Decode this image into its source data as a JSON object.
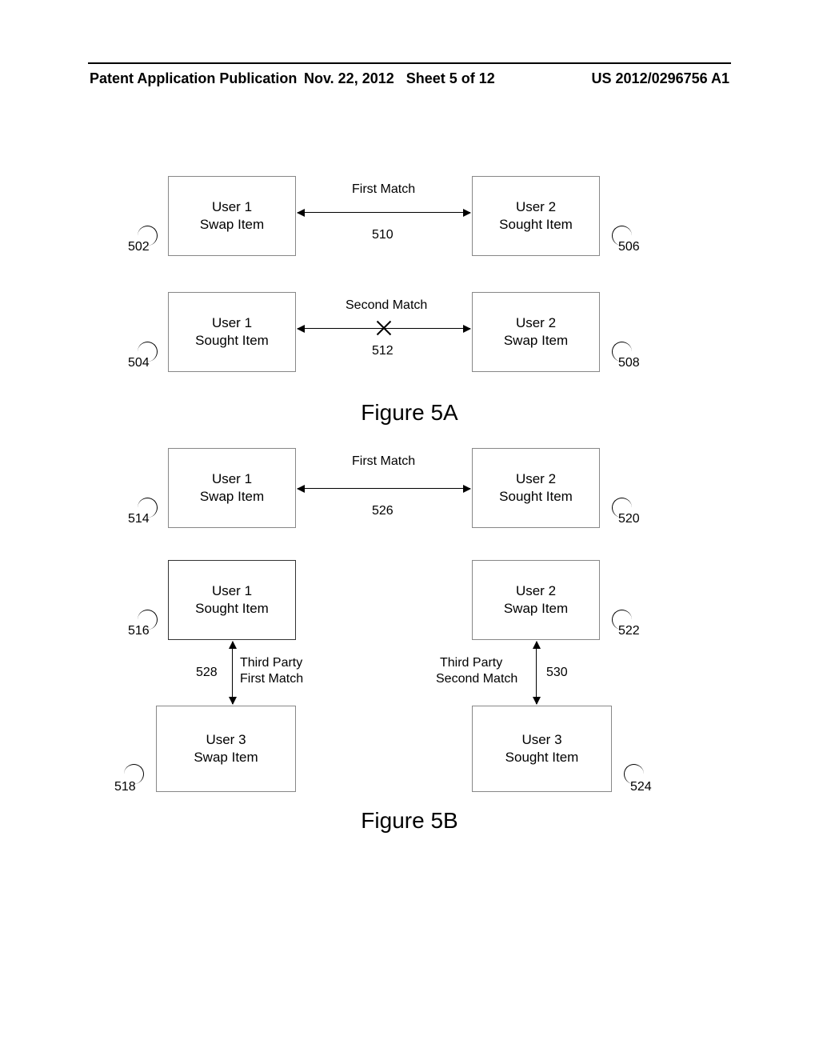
{
  "header": {
    "left": "Patent Application Publication",
    "mid_date": "Nov. 22, 2012",
    "mid_sheet": "Sheet 5 of 12",
    "right": "US 2012/0296756 A1"
  },
  "fig5a": {
    "title": "Figure 5A",
    "boxes": {
      "b502": {
        "l1": "User 1",
        "l2": "Swap Item",
        "ref": "502"
      },
      "b506": {
        "l1": "User 2",
        "l2": "Sought Item",
        "ref": "506"
      },
      "b504": {
        "l1": "User 1",
        "l2": "Sought Item",
        "ref": "504"
      },
      "b508": {
        "l1": "User 2",
        "l2": "Swap Item",
        "ref": "508"
      }
    },
    "arrows": {
      "a510": {
        "label": "First Match",
        "ref": "510"
      },
      "a512": {
        "label": "Second Match",
        "ref": "512"
      }
    }
  },
  "fig5b": {
    "title": "Figure 5B",
    "boxes": {
      "b514": {
        "l1": "User 1",
        "l2": "Swap Item",
        "ref": "514"
      },
      "b520": {
        "l1": "User 2",
        "l2": "Sought Item",
        "ref": "520"
      },
      "b516": {
        "l1": "User 1",
        "l2": "Sought Item",
        "ref": "516"
      },
      "b522": {
        "l1": "User 2",
        "l2": "Swap Item",
        "ref": "522"
      },
      "b518": {
        "l1": "User 3",
        "l2": "Swap Item",
        "ref": "518"
      },
      "b524": {
        "l1": "User 3",
        "l2": "Sought Item",
        "ref": "524"
      }
    },
    "arrows": {
      "a526": {
        "label": "First Match",
        "ref": "526"
      },
      "a528": {
        "label_l1": "Third Party",
        "label_l2": "First Match",
        "ref": "528"
      },
      "a530": {
        "label_l1": "Third Party",
        "label_l2": "Second Match",
        "ref": "530"
      }
    }
  }
}
